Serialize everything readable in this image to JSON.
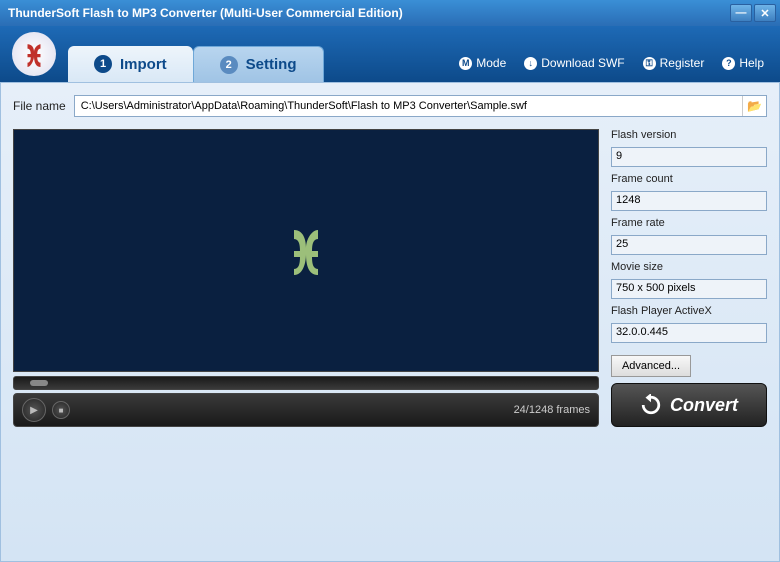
{
  "window": {
    "title": "ThunderSoft Flash to MP3 Converter (Multi-User Commercial Edition)"
  },
  "tabs": {
    "import": {
      "num": "1",
      "label": "Import"
    },
    "setting": {
      "num": "2",
      "label": "Setting"
    }
  },
  "headerLinks": {
    "mode": "Mode",
    "download": "Download SWF",
    "register": "Register",
    "help": "Help"
  },
  "file": {
    "label": "File name",
    "path": "C:\\Users\\Administrator\\AppData\\Roaming\\ThunderSoft\\Flash to MP3 Converter\\Sample.swf"
  },
  "info": {
    "flashVersionLabel": "Flash version",
    "flashVersion": "9",
    "frameCountLabel": "Frame count",
    "frameCount": "1248",
    "frameRateLabel": "Frame rate",
    "frameRate": "25",
    "movieSizeLabel": "Movie size",
    "movieSize": "750 x 500 pixels",
    "activexLabel": "Flash Player ActiveX",
    "activex": "32.0.0.445"
  },
  "advanced": "Advanced...",
  "player": {
    "frames": "24/1248 frames"
  },
  "convert": "Convert"
}
